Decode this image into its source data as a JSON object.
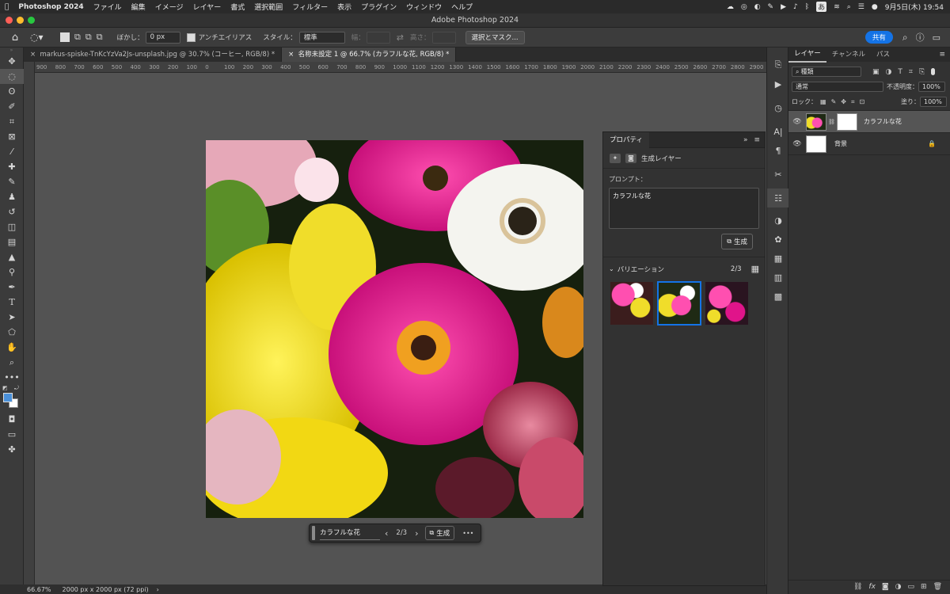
{
  "menubar": {
    "app": "Photoshop 2024",
    "items": [
      "ファイル",
      "編集",
      "イメージ",
      "レイヤー",
      "書式",
      "選択範囲",
      "フィルター",
      "表示",
      "プラグイン",
      "ウィンドウ",
      "ヘルプ"
    ],
    "ime": "あ",
    "datetime": "9月5日(木) 19:54"
  },
  "window": {
    "title": "Adobe Photoshop 2024"
  },
  "options": {
    "blur_label": "ぼかし：",
    "blur_value": "0 px",
    "antialias_label": "アンチエイリアス",
    "style_label": "スタイル：",
    "style_value": "標準",
    "width_label": "幅：",
    "height_label": "高さ：",
    "select_mask": "選択とマスク...",
    "share": "共有"
  },
  "tabs": [
    {
      "label": "markus-spiske-TnKcYzVa2Js-unsplash.jpg @ 30.7% (コーヒー, RGB/8) *"
    },
    {
      "label": "名称未設定 1 @ 66.7% (カラフルな花, RGB/8) *"
    }
  ],
  "ruler": {
    "ticks": [
      "900",
      "800",
      "700",
      "600",
      "500",
      "400",
      "300",
      "200",
      "100",
      "0",
      "100",
      "200",
      "300",
      "400",
      "500",
      "600",
      "700",
      "800",
      "900",
      "1000",
      "1100",
      "1200",
      "1300",
      "1400",
      "1500",
      "1600",
      "1700",
      "1800",
      "1900",
      "2000",
      "2100",
      "2200",
      "2300",
      "2400",
      "2500",
      "2600",
      "2700",
      "2800",
      "2900"
    ]
  },
  "contextbar": {
    "prompt": "カラフルな花",
    "page": "2/3",
    "generate": "生成",
    "more": "•••"
  },
  "status": {
    "zoom": "66.67%",
    "docinfo": "2000 px x 2000 px (72 ppi)"
  },
  "properties": {
    "tab": "プロパティ",
    "layer_type": "生成レイヤー",
    "prompt_label": "プロンプト：",
    "prompt_value": "カラフルな花",
    "generate": "生成",
    "variations_label": "バリエーション",
    "variations_count": "2/3"
  },
  "layers_panel": {
    "tabs": [
      "レイヤー",
      "チャンネル",
      "パス"
    ],
    "kind_filter": "種類",
    "blend_mode": "通常",
    "opacity_label": "不透明度：",
    "opacity_value": "100%",
    "lock_label": "ロック：",
    "fill_label": "塗り：",
    "fill_value": "100%",
    "layers": [
      {
        "name": "カラフルな花",
        "selected": true
      },
      {
        "name": "背景",
        "selected": false
      }
    ]
  },
  "colors": {
    "accent": "#1473e6",
    "foreground": "#4a90d9",
    "background": "#ffffff"
  }
}
